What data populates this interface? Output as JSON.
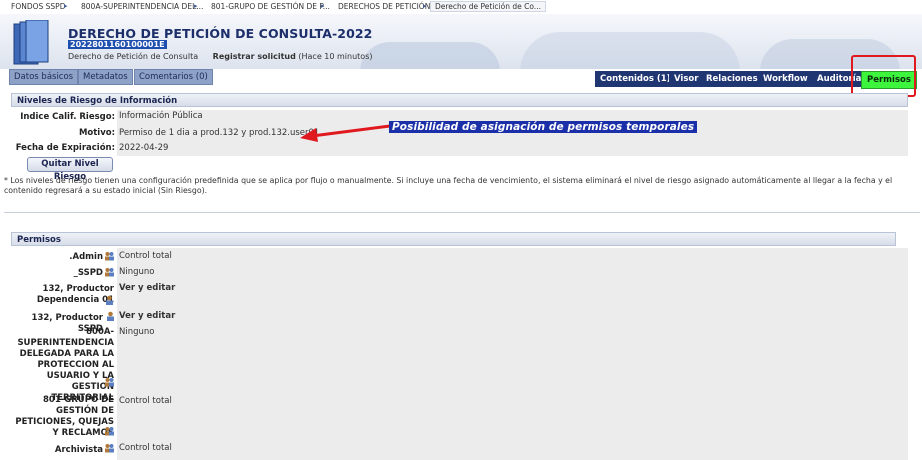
{
  "breadcrumb": [
    "FONDOS SSPD",
    "800A-SUPERINTENDENCIA DEL...",
    "801-GRUPO DE GESTIÓN DE P...",
    "DERECHOS DE PETICIÓN",
    "Derecho de Petición de Co..."
  ],
  "header": {
    "title": "DERECHO DE PETICIÓN DE CONSULTA-2022",
    "doc_number": "2022801160100001E",
    "doc_type": "Derecho de Petición de Consulta",
    "registered_label": "Registrar solicitud",
    "registered_time": "(Hace 10 minutos)"
  },
  "tabs_left": [
    "Datos básicos",
    "Metadatos",
    "Comentarios (0)"
  ],
  "tabs_right": [
    "Contenidos (1)",
    "Visor",
    "Relaciones",
    "Workflow",
    "Auditoría",
    "Permisos"
  ],
  "risk": {
    "section_title": "Niveles de Riesgo de Información",
    "fields": [
      {
        "label": "Indice Calif. Riesgo:",
        "value": "Información Pública"
      },
      {
        "label": "Motivo:",
        "value": "Permiso de 1 dia a prod.132 y prod.132.user01"
      },
      {
        "label": "Fecha de Expiración:",
        "value": "2022-04-29"
      }
    ],
    "button": "Quitar Nivel Riesgo",
    "note": "* Los niveles de riesgo tienen una configuración predefinida que se aplica por flujo o manualmente. Si incluye una fecha de vencimiento, el sistema eliminará el nivel de riesgo asignado automáticamente al llegar a la fecha y el contenido regresará a su estado inicial (Sin Riesgo)."
  },
  "annotation": "Posibilidad de asignación de permisos temporales",
  "permissions": {
    "section_title": "Permisos",
    "rows": [
      {
        "name": ".Admin",
        "value": "Control total",
        "icon": "group-icon"
      },
      {
        "name": "_SSPD",
        "value": "Ninguno",
        "icon": "group-icon"
      },
      {
        "name": "132, Productor Dependencia 01",
        "value": "Ver y editar",
        "icon": "user-icon"
      },
      {
        "name": "132, Productor SSPD",
        "value": "Ver y editar",
        "icon": "user-icon"
      },
      {
        "name": "800A-SUPERINTENDENCIA DELEGADA PARA LA PROTECCION AL USUARIO Y LA GESTION TERRITORIAL",
        "value": "Ninguno",
        "icon": "group-icon"
      },
      {
        "name": "801-GRUPO DE GESTIÓN DE PETICIONES, QUEJAS Y RECLAMOS",
        "value": "Control total",
        "icon": "group-icon"
      },
      {
        "name": "Archivista",
        "value": "Control total",
        "icon": "group-icon"
      }
    ]
  },
  "colors": {
    "accent": "#1f3673",
    "active_tab": "#3cf53c",
    "highlight": "#e0191f",
    "annotation_bg": "#1b2fa8"
  }
}
